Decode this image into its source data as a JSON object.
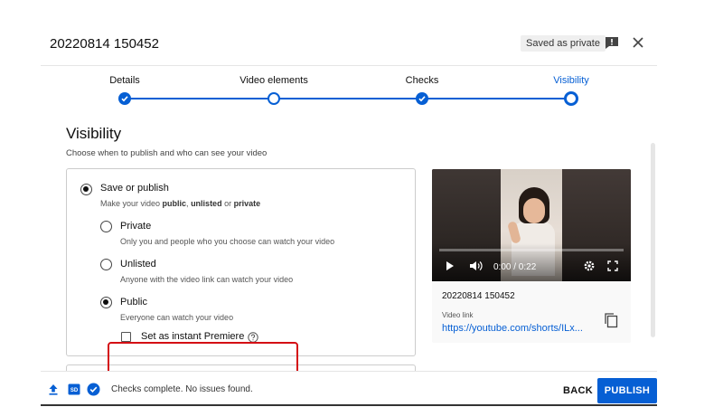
{
  "header": {
    "title": "20220814 150452",
    "saved_status": "Saved as private",
    "feedback_icon": "feedback-icon",
    "close_icon": "close-icon"
  },
  "stepper": {
    "steps": [
      {
        "label": "Details",
        "state": "done"
      },
      {
        "label": "Video elements",
        "state": "open"
      },
      {
        "label": "Checks",
        "state": "done"
      },
      {
        "label": "Visibility",
        "state": "current"
      }
    ],
    "accent_color": "#065fd4"
  },
  "visibility": {
    "title": "Visibility",
    "subtitle": "Choose when to publish and who can see your video",
    "save_or_publish": {
      "label": "Save or publish",
      "description_prefix": "Make your video ",
      "description_public": "public",
      "description_sep1": ", ",
      "description_unlisted": "unlisted",
      "description_sep2": " or ",
      "description_private": "private",
      "selected": true
    },
    "options": [
      {
        "label": "Private",
        "description": "Only you and people who you choose can watch your video",
        "selected": false
      },
      {
        "label": "Unlisted",
        "description": "Anyone with the video link can watch your video",
        "selected": false
      },
      {
        "label": "Public",
        "description": "Everyone can watch your video",
        "selected": true
      }
    ],
    "premiere": {
      "label": "Set as instant Premiere",
      "checked": false,
      "help_icon": "help-circle-icon"
    },
    "highlight_color": "#d40f14"
  },
  "preview": {
    "time": "0:00 / 0:22",
    "progress": 0,
    "video_title": "20220814 150452",
    "link_label": "Video link",
    "link_text": "https://youtube.com/shorts/ILx...",
    "controls": [
      "play-icon",
      "volume-icon",
      "settings-icon",
      "fullscreen-icon"
    ]
  },
  "footer": {
    "status": "Checks complete. No issues found.",
    "icons": [
      "upload-icon",
      "sd-badge-icon",
      "check-circle-icon"
    ],
    "back_label": "BACK",
    "publish_label": "PUBLISH"
  }
}
